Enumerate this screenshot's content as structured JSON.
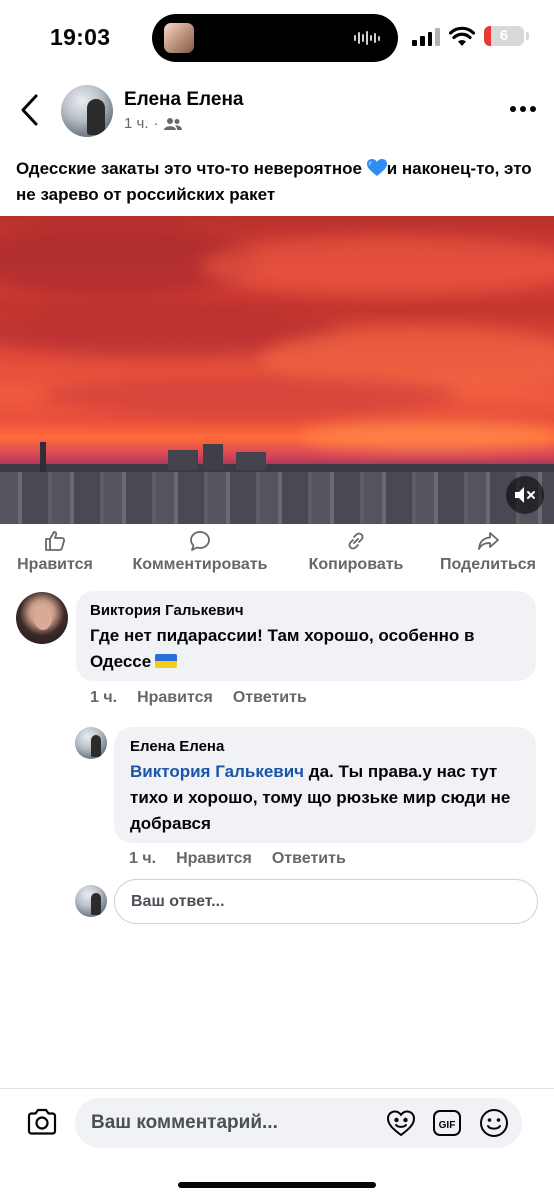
{
  "status_bar": {
    "time": "19:03",
    "battery": "6",
    "icons": [
      "cellular-signal-icon",
      "wifi-icon",
      "battery-low-icon"
    ],
    "colors": {
      "battery_low": "#e53935"
    }
  },
  "post": {
    "author": "Елена Елена",
    "time": "1 ч.",
    "separator": "·",
    "audience_icon": "friends-icon",
    "text_before_emoji": "Одесские закаты это что-то невероятное ",
    "emoji": "blue-heart-icon",
    "text_after_emoji": "и наконец-то, это не зарево от российских ракет",
    "media": {
      "type": "video",
      "muted": true
    }
  },
  "actions": [
    {
      "label": "Нравится",
      "icon": "like-icon"
    },
    {
      "label": "Комментировать",
      "icon": "comment-icon"
    },
    {
      "label": "Копировать",
      "icon": "link-icon"
    },
    {
      "label": "Поделиться",
      "icon": "share-icon"
    }
  ],
  "comments": [
    {
      "author": "Виктория Галькевич",
      "text": "Где нет пидарассии! Там хорошо, особенно в Одессе",
      "flag": "ukraine-flag-icon",
      "time": "1 ч.",
      "like": "Нравится",
      "reply": "Ответить",
      "replies": [
        {
          "author": "Елена Елена",
          "mention": "Виктория Галькевич",
          "text": " да. Ты права.у нас тут тихо и хорошо, тому що рюзьке мир сюди не добрався",
          "time": "1 ч.",
          "like": "Нравится",
          "reply": "Ответить"
        }
      ]
    }
  ],
  "reply_box": {
    "placeholder": "Ваш ответ..."
  },
  "composer": {
    "placeholder": "Ваш комментарий...",
    "icons": [
      "camera-icon",
      "sticker-icon",
      "gif-icon",
      "emoji-icon"
    ]
  },
  "colors": {
    "accent_link": "#1a55a8",
    "secondary_text": "#65676b",
    "bubble_bg": "#f0f2f5"
  }
}
